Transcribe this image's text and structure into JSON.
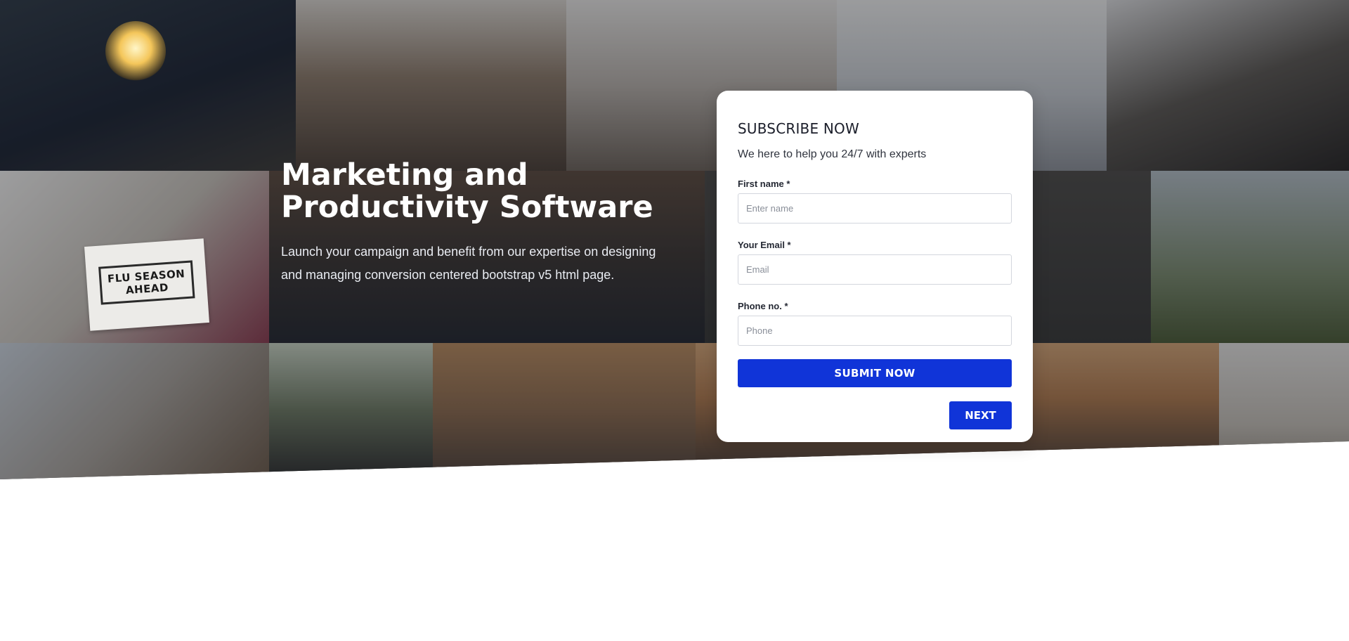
{
  "hero": {
    "title_line1": "Marketing and",
    "title_line2": "Productivity Software",
    "description": "Launch your campaign and benefit from our expertise on designing and managing conversion centered bootstrap v5 html page.",
    "photo_sign_text": "FLU SEASON AHEAD"
  },
  "form": {
    "title": "SUBSCRIBE NOW",
    "subtitle": "We here to help you 24/7 with experts",
    "fields": [
      {
        "label": "First name *",
        "placeholder": "Enter name",
        "value": ""
      },
      {
        "label": "Your Email *",
        "placeholder": "Email",
        "value": ""
      },
      {
        "label": "Phone no. *",
        "placeholder": "Phone",
        "value": ""
      }
    ],
    "submit_label": "SUBMIT NOW",
    "next_label": "NEXT"
  },
  "colors": {
    "accent": "#1034d8",
    "card_background": "#ffffff",
    "hero_overlay": "#12161e"
  }
}
